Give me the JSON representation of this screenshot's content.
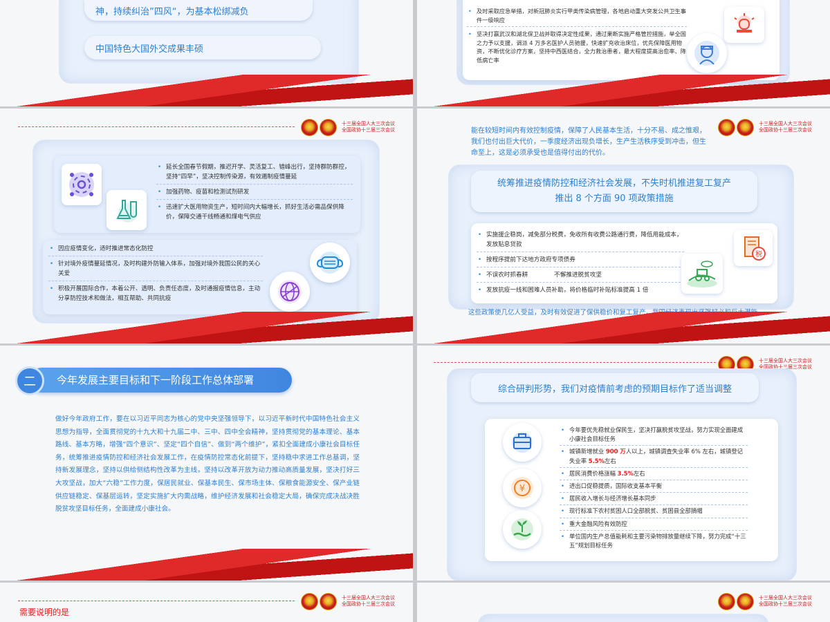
{
  "common": {
    "badge_line1": "十三届全国人大三次会议",
    "badge_line2": "全国政协十三届三次会议"
  },
  "s1": {
    "pill1": "神，持续纠治”四风“，为基本松绑减负",
    "pill2": "中国特色大国外交成果丰硕"
  },
  "s2": {
    "items": [
      "及时采取应急举措，对新冠肺炎实行甲类传染病管理，各地启动重大突发公共卫生事件一级响应",
      "坚决打赢武汉和湖北保卫战并取得决定性成果，通过果断实施严格管控措施，举全国之力予以支援，调派 4 万多名医护人员驰援，快速扩充收治床位，优先保障医用物资，不断优化诊疗方案，坚持中西医结合，全力救治患者，最大程度提高治愈率、降低病亡率"
    ]
  },
  "s3": {
    "top_items": [
      "延长全国春节假期，推迟开学、灵活复工、错峰出行，坚持群防群控，坚持“四早”，坚决控制传染源，有效遏制疫情蔓延",
      "加强药物、疫苗和检测试剂研发",
      "迅速扩大医用物资生产，短时间内大幅增长，抓好生活必需品保供降价，保障交通干线畅通和煤电气供应"
    ],
    "bottom_items": [
      "因应疫情变化，适时推进常态化防控",
      "针对境外疫情蔓延情况，及时构建外防输入体系，加强对境外我国公民的关心关爱",
      "积极开展国际合作，本着公开、透明、负责任态度，及时通报疫情信息，主动分享防控技术和做法，相互帮助、共同抗疫"
    ]
  },
  "s4": {
    "intro": "能在较短时间内有效控制疫情，保障了人民基本生活，十分不易、成之惟艰，我们也付出巨大代价，一季度经济出现负增长，生产生活秩序受到冲击，但生命至上，这是必须承受也是值得付出的代价。",
    "banner_line1": "统筹推进疫情防控和经济社会发展，不失时机推进复工复产",
    "banner_line2": "推出 8 个方面 90 项政策措施",
    "items": [
      "实施援企稳岗，减免部分税费，免收所有收费公路通行费，降低用能成本，发放贴息贷款",
      "按程序提前下达地方政府专项债券",
      "不误农时抓春耕",
      "不懈推进脱贫攻坚",
      "发放抗疫一线和困难人员补助，将价格临时补贴标准提高 1 倍"
    ],
    "tax_label": "税",
    "outro": "这些政策使几亿人受益，及时有效促进了保供稳价和复工复产，我国经济表现出坚强韧必和巨大潜能。"
  },
  "s5": {
    "num": "二",
    "title": "今年发展主要目标和下一阶段工作总体部署",
    "body": "做好今年政府工作，要在以习近平同志为核心的党中央坚强领导下，以习近平新时代中国特色社会主义思想为指导，全面贯彻党的十九大和十九届二中、三中、四中全会精神，坚持贯彻党的基本理论、基本路线、基本方略，增强“四个意识”、坚定“四个自信”、做到“两个维护”，紧扣全面建成小康社会目标任务，统筹推进疫情防控和经济社会发展工作，在疫情防控常态化前提下，坚持稳中求进工作总基调，坚持新发展理念，坚持以供给侧结构性改革为主线，坚持以改革开放为动力推动高质量发展，坚决打好三大攻坚战，加大“六稳”工作力度，保居民就业、保基本民生、保市场主体、保粮食能源安全、保产业链供应链稳定、保基层运转，坚定实施扩大内需战略，维护经济发展和社会稳定大局，确保完成决战决胜脱贫攻坚目标任务，全面建成小康社会。"
  },
  "s6": {
    "banner": "综合研判形势，我们对疫情前考虑的预期目标作了适当调整",
    "item1": "今年要优先稳就业保民生，坚决打赢脱贫攻坚战，努力实现全面建成小康社会目标任务",
    "item2_a": "城镇新增就业 ",
    "item2_b": "900 万",
    "item2_c": "人以上，城镇调查失业率 6% 左右，城镇登记失业率 ",
    "item2_d": "5.5%",
    "item2_e": "左右",
    "item3_a": "居民消费价格涨幅 ",
    "item3_b": "3.5%",
    "item3_c": "左右",
    "item4": "进出口促稳提质，国际收支基本平衡",
    "item5": "居民收入增长与经济增长基本同步",
    "item6": "现行标准下农村贫困人口全部脱贫、贫困县全部摘帽",
    "item7": "重大金融风险有效防控",
    "item8": "单位国内生产总值能耗和主要污染物排放量继续下降，努力完成“十三五”规划目标任务",
    "yen": "¥"
  },
  "s7": {
    "title": "需要说明的是"
  },
  "colors": {
    "accent_blue": "#2d7fd3",
    "accent_red": "#e02020"
  }
}
